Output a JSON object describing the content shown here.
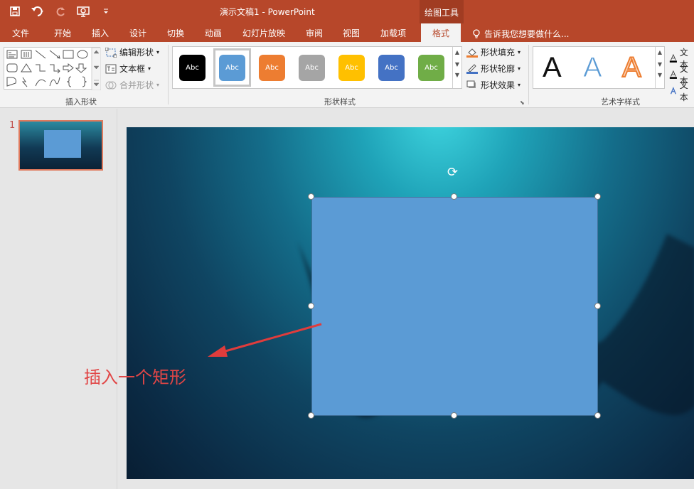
{
  "window": {
    "title": "演示文稿1 - PowerPoint",
    "contextual_tab_group": "绘图工具"
  },
  "quick_access": [
    "save-icon",
    "undo-icon",
    "redo-icon",
    "present-icon",
    "customize-icon"
  ],
  "tabs": [
    {
      "label": "文件"
    },
    {
      "label": "开始"
    },
    {
      "label": "插入"
    },
    {
      "label": "设计"
    },
    {
      "label": "切换"
    },
    {
      "label": "动画"
    },
    {
      "label": "幻灯片放映"
    },
    {
      "label": "审阅"
    },
    {
      "label": "视图"
    },
    {
      "label": "加载项"
    },
    {
      "label": "格式",
      "active": true
    }
  ],
  "tell_me": "告诉我您想要做什么...",
  "ribbon": {
    "insert_shapes": {
      "label": "插入形状",
      "edit_shape": "编辑形状",
      "text_box": "文本框",
      "merge_shapes": "合并形状"
    },
    "shape_styles": {
      "label": "形状样式",
      "swatches": [
        {
          "text": "Abc",
          "color": "#000000"
        },
        {
          "text": "Abc",
          "color": "#5b9bd5",
          "selected": true
        },
        {
          "text": "Abc",
          "color": "#ed7d31"
        },
        {
          "text": "Abc",
          "color": "#a5a5a5"
        },
        {
          "text": "Abc",
          "color": "#ffc000"
        },
        {
          "text": "Abc",
          "color": "#4472c4"
        },
        {
          "text": "Abc",
          "color": "#70ad47"
        }
      ],
      "fill": "形状填充",
      "outline": "形状轮廓",
      "effects": "形状效果"
    },
    "wordart": {
      "label": "艺术字样式",
      "samples": [
        "A",
        "A",
        "A"
      ],
      "text_cmd": "文本",
      "text_cmd2": "文本",
      "text_cmd3": "文本"
    }
  },
  "thumbnails": [
    {
      "number": "1"
    }
  ],
  "slide": {
    "shape_fill": "#5b9bd5",
    "annotation": "插入一个矩形"
  }
}
